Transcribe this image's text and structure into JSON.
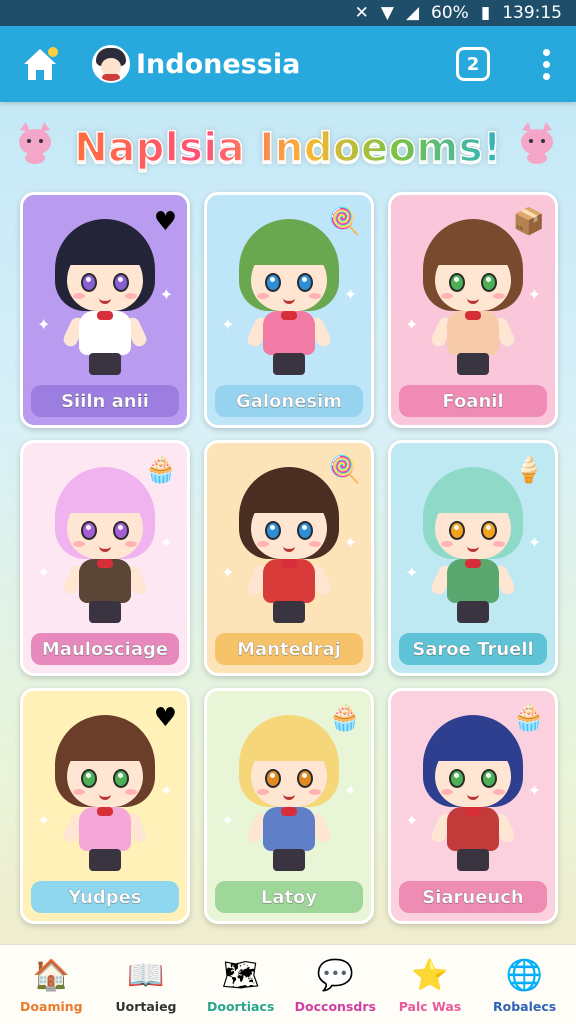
{
  "status_bar": {
    "battery": "60%",
    "time": "139:15"
  },
  "app_bar": {
    "title": "Indonessia"
  },
  "banner": {
    "title": "Naplsia Indoeoms!"
  },
  "cards": [
    {
      "label": "Siiln anii",
      "bg": "#b99cf0",
      "label_bg": "#9c7ee0",
      "hair": "#232437",
      "eye": "#8a5fd6",
      "outfit": "#ffffff",
      "prop": "♥"
    },
    {
      "label": "Galonesim",
      "bg": "#bfe6f8",
      "label_bg": "#96d3ee",
      "hair": "#6aa84f",
      "eye": "#2d8fd8",
      "outfit": "#f27ba5",
      "prop": "🍭"
    },
    {
      "label": "Foanil",
      "bg": "#f9c6da",
      "label_bg": "#f08bb5",
      "hair": "#7a4a2e",
      "eye": "#4caf50",
      "outfit": "#f7cba9",
      "prop": "📦"
    },
    {
      "label": "Maulosciage",
      "bg": "#fde7f2",
      "label_bg": "#e889be",
      "hair": "#f0b3f0",
      "eye": "#a55fd6",
      "outfit": "#5a4536",
      "prop": "🧁"
    },
    {
      "label": "Mantedraj",
      "bg": "#fde3b8",
      "label_bg": "#f6c36a",
      "hair": "#4a2e22",
      "eye": "#2d8fd8",
      "outfit": "#d93b3b",
      "prop": "🍭"
    },
    {
      "label": "Saroe Truell",
      "bg": "#bfe9f2",
      "label_bg": "#5ec3d6",
      "hair": "#8fd9c8",
      "eye": "#f3a41c",
      "outfit": "#5aa870",
      "prop": "🍦"
    },
    {
      "label": "Yudpes",
      "bg": "#fff1b8",
      "label_bg": "#8ed7ef",
      "hair": "#6a3e28",
      "eye": "#4caf50",
      "outfit": "#f4a6d6",
      "prop": "♥"
    },
    {
      "label": "Latoy",
      "bg": "#e8f5d6",
      "label_bg": "#9fd79a",
      "hair": "#f5d77a",
      "eye": "#e08a1f",
      "outfit": "#5f7fc8",
      "prop": "🧁"
    },
    {
      "label": "Siarueuch",
      "bg": "#fbd1e0",
      "label_bg": "#ee8cb4",
      "hair": "#2e3f8f",
      "eye": "#4caf50",
      "outfit": "#c23a3a",
      "prop": "🧁"
    }
  ],
  "bottom_nav": [
    {
      "label": "Doaming",
      "color": "#ec7a2c",
      "icon": "🏠"
    },
    {
      "label": "Uortaieg",
      "color": "#333333",
      "icon": "📖"
    },
    {
      "label": "Doortiacs",
      "color": "#27a58d",
      "icon": "🗺"
    },
    {
      "label": "Docconsdrs",
      "color": "#d13ea3",
      "icon": "💬"
    },
    {
      "label": "Palc Was",
      "color": "#ea5a9b",
      "icon": "⭐"
    },
    {
      "label": "Robalecs",
      "color": "#2f63b5",
      "icon": "🌐"
    }
  ]
}
